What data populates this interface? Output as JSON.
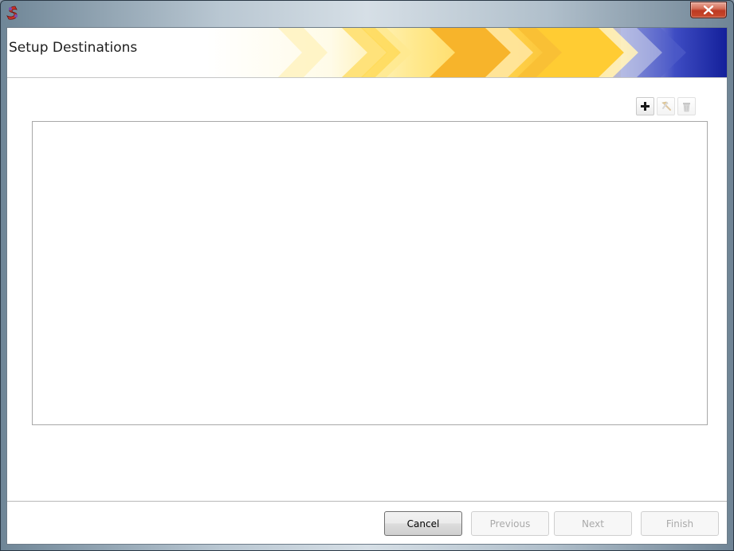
{
  "window": {
    "app_icon": "app-logo-icon",
    "close_icon": "close-icon"
  },
  "header": {
    "title": "Setup Destinations"
  },
  "toolbar": {
    "add_icon": "plus-icon",
    "edit_icon": "hammer-icon",
    "delete_icon": "trash-icon"
  },
  "destinations": {
    "items": []
  },
  "footer": {
    "cancel_label": "Cancel",
    "previous_label": "Previous",
    "next_label": "Next",
    "finish_label": "Finish"
  },
  "colors": {
    "chevron_yellow": "#ffcc33",
    "chevron_orange": "#f7b42b",
    "banner_blue": "#1d2aa8",
    "close_red": "#c9452b"
  }
}
